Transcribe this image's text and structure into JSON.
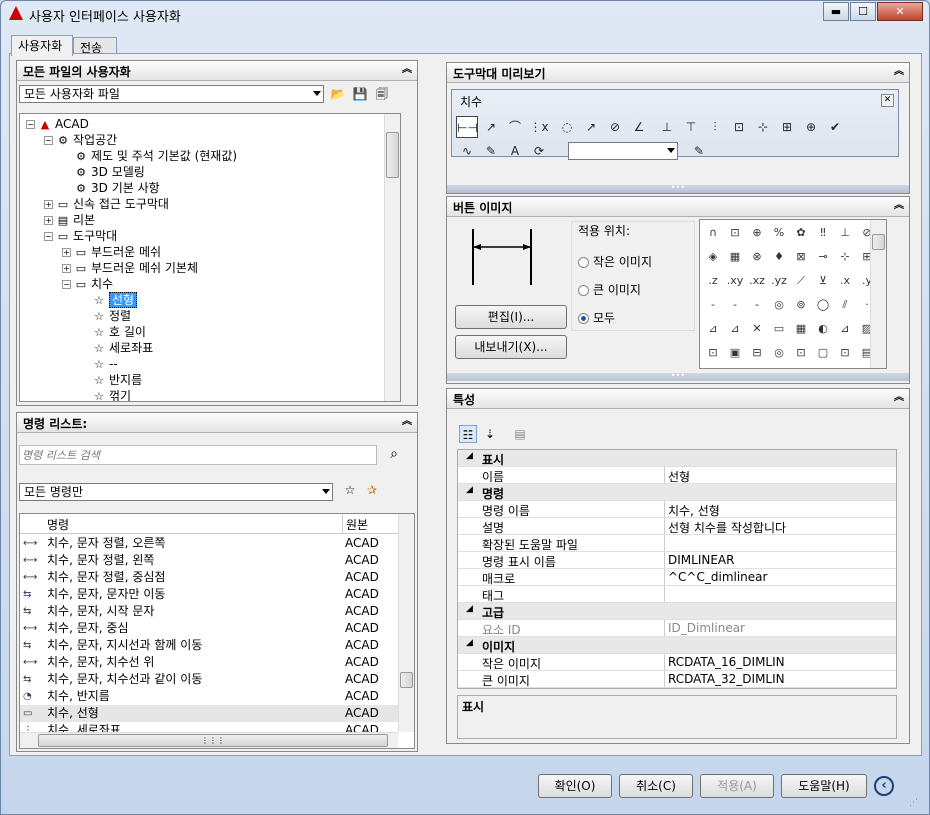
{
  "window": {
    "title": "사용자 인터페이스 사용자화"
  },
  "tabs": [
    "사용자화",
    "전송"
  ],
  "files_panel": {
    "title": "모든 파일의 사용자화",
    "file_combo": "모든 사용자화 파일"
  },
  "tree": [
    {
      "label": "ACAD",
      "icon": "acad-icon",
      "indent": 0,
      "toggle": "⊟"
    },
    {
      "label": "작업공간",
      "icon": "gear-icon",
      "indent": 1,
      "toggle": "⊟"
    },
    {
      "label": "제도 및 주석 기본값 (현재값)",
      "icon": "gear-icon",
      "indent": 2,
      "toggle": ""
    },
    {
      "label": "3D 모델링",
      "icon": "gear-icon",
      "indent": 2,
      "toggle": ""
    },
    {
      "label": "3D 기본 사항",
      "icon": "gear-icon",
      "indent": 2,
      "toggle": ""
    },
    {
      "label": "신속 접근 도구막대",
      "icon": "toolbar-icon",
      "indent": 1,
      "toggle": "⊞"
    },
    {
      "label": "리본",
      "icon": "ribbon-icon",
      "indent": 1,
      "toggle": "⊞"
    },
    {
      "label": "도구막대",
      "icon": "toolbar-icon",
      "indent": 1,
      "toggle": "⊟"
    },
    {
      "label": "부드러운 메쉬",
      "icon": "toolbar-icon",
      "indent": 2,
      "toggle": "⊞"
    },
    {
      "label": "부드러운 메쉬 기본체",
      "icon": "toolbar-icon",
      "indent": 2,
      "toggle": "⊞"
    },
    {
      "label": "치수",
      "icon": "toolbar-icon",
      "indent": 2,
      "toggle": "⊟"
    },
    {
      "label": "선형",
      "icon": "star-icon",
      "indent": 3,
      "toggle": "",
      "selected": true
    },
    {
      "label": "정렬",
      "icon": "star-icon",
      "indent": 3,
      "toggle": ""
    },
    {
      "label": "호 길이",
      "icon": "star-icon",
      "indent": 3,
      "toggle": ""
    },
    {
      "label": "세로좌표",
      "icon": "star-icon",
      "indent": 3,
      "toggle": ""
    },
    {
      "label": "--",
      "icon": "star-icon",
      "indent": 3,
      "toggle": ""
    },
    {
      "label": "반지름",
      "icon": "star-icon",
      "indent": 3,
      "toggle": ""
    },
    {
      "label": "꺾기",
      "icon": "star-icon",
      "indent": 3,
      "toggle": ""
    }
  ],
  "command_panel": {
    "title": "명령 리스트:",
    "search_placeholder": "명령 리스트 검색",
    "filter_combo": "모든 명령만",
    "col_name": "명령",
    "col_source": "원본"
  },
  "commands": [
    {
      "name": "치수, 문자 정렬, 오른쪽",
      "source": "ACAD"
    },
    {
      "name": "치수, 문자 정렬, 왼쪽",
      "source": "ACAD"
    },
    {
      "name": "치수, 문자 정렬, 중심점",
      "source": "ACAD"
    },
    {
      "name": "치수, 문자, 문자만 이동",
      "source": "ACAD"
    },
    {
      "name": "치수, 문자, 시작 문자",
      "source": "ACAD"
    },
    {
      "name": "치수, 문자, 중심",
      "source": "ACAD"
    },
    {
      "name": "치수, 문자, 지시선과 함께 이동",
      "source": "ACAD"
    },
    {
      "name": "치수, 문자, 치수선 위",
      "source": "ACAD"
    },
    {
      "name": "치수, 문자, 치수선과 같이 이동",
      "source": "ACAD"
    },
    {
      "name": "치수, 반지름",
      "source": "ACAD"
    },
    {
      "name": "치수, 선형",
      "source": "ACAD",
      "selected": true
    },
    {
      "name": "치수, 세로좌표",
      "source": "ACAD"
    }
  ],
  "preview_panel": {
    "title": "도구막대 미리보기",
    "toolbar_title": "치수"
  },
  "button_image_panel": {
    "title": "버튼 이미지",
    "apply_label": "적용 위치:",
    "radio": [
      "작은 이미지",
      "큰 이미지",
      "모두"
    ],
    "radio_selected": 2,
    "edit_button": "편집(I)...",
    "export_button": "내보내기(X)..."
  },
  "properties_panel": {
    "title": "특성",
    "desc_title": "표시"
  },
  "properties": [
    {
      "type": "cat",
      "key": "표시"
    },
    {
      "type": "row",
      "key": "이름",
      "value": "선형"
    },
    {
      "type": "cat",
      "key": "명령"
    },
    {
      "type": "row",
      "key": "명령 이름",
      "value": "치수, 선형"
    },
    {
      "type": "row",
      "key": "설명",
      "value": "선형 치수를 작성합니다"
    },
    {
      "type": "row",
      "key": "확장된 도움말 파일",
      "value": ""
    },
    {
      "type": "row",
      "key": "명령 표시 이름",
      "value": "DIMLINEAR"
    },
    {
      "type": "row",
      "key": "매크로",
      "value": "^C^C_dimlinear"
    },
    {
      "type": "row",
      "key": "태그",
      "value": ""
    },
    {
      "type": "cat",
      "key": "고급"
    },
    {
      "type": "row",
      "key": "요소 ID",
      "value": "ID_Dimlinear",
      "grey": true
    },
    {
      "type": "cat",
      "key": "이미지"
    },
    {
      "type": "row",
      "key": "작은 이미지",
      "value": "RCDATA_16_DIMLIN"
    },
    {
      "type": "row",
      "key": "큰 이미지",
      "value": "RCDATA_32_DIMLIN"
    }
  ],
  "footer": {
    "ok": "확인(O)",
    "cancel": "취소(C)",
    "apply": "적용(A)",
    "help": "도움말(H)"
  }
}
